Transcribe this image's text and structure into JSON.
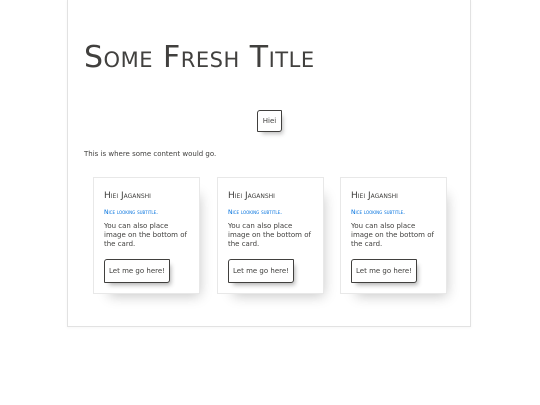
{
  "page": {
    "title": "Some Fresh Title",
    "button_label": "Hiei",
    "content_text": "This is where some content would go."
  },
  "cards": [
    {
      "title": "Hiei Jaganshi",
      "subtitle": "Nice looking subtitle.",
      "text": "You can also place image on the bottom of the card.",
      "button_label": "Let me go here!"
    },
    {
      "title": "Hiei Jaganshi",
      "subtitle": "Nice looking subtitle.",
      "text": "You can also place image on the bottom of the card.",
      "button_label": "Let me go here!"
    },
    {
      "title": "Hiei Jaganshi",
      "subtitle": "Nice looking subtitle.",
      "text": "You can also place image on the bottom of the card.",
      "button_label": "Let me go here!"
    }
  ],
  "colors": {
    "text": "#41403e",
    "subtitle": "#0071de",
    "border": "#e2e2e2"
  }
}
